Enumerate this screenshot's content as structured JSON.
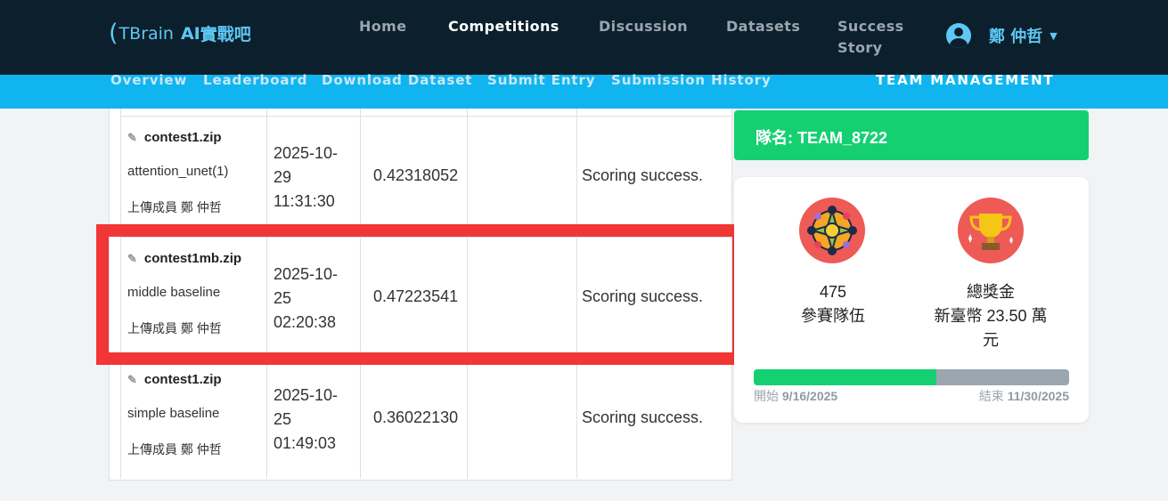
{
  "header": {
    "logo_text": "TBrain",
    "logo_ai": "AI",
    "logo_cn": "實戰吧",
    "nav": [
      "Home",
      "Competitions",
      "Discussion",
      "Datasets",
      "Success",
      "Story"
    ],
    "active_nav": "Competitions",
    "user_name": "鄭 仲哲"
  },
  "subnav": {
    "items": [
      "Overview",
      "Leaderboard",
      "Download Dataset",
      "Submit Entry",
      "Submission History"
    ],
    "team_management": "TEAM MANAGEMENT"
  },
  "submissions": [
    {
      "file": "contest1.zip",
      "description": "attention_unet(1)",
      "uploader": "上傳成員 鄭 仲哲",
      "date_lines": [
        "2025-10-",
        "29",
        "11:31:30"
      ],
      "score": "0.42318052",
      "status": "Scoring success."
    },
    {
      "file": "contest1mb.zip",
      "description": "middle baseline",
      "uploader": "上傳成員 鄭 仲哲",
      "date_lines": [
        "2025-10-",
        "25",
        "02:20:38"
      ],
      "score": "0.47223541",
      "status": "Scoring success."
    },
    {
      "file": "contest1.zip",
      "description": "simple baseline",
      "uploader": "上傳成員 鄭 仲哲",
      "date_lines": [
        "2025-10-",
        "25",
        "01:49:03"
      ],
      "score": "0.36022130",
      "status": "Scoring success."
    }
  ],
  "team": {
    "label": "隊名: TEAM_8722"
  },
  "stats": {
    "teams_count": "475",
    "teams_label": "參賽隊伍",
    "prize_label": "總獎金",
    "prize_line1": "新臺幣 23.50 萬",
    "prize_line2": "元",
    "start_label": "開始",
    "start_date": "9/16/2025",
    "end_label": "結束",
    "end_date": "11/30/2025",
    "progress": 0.58
  },
  "colors": {
    "navbar": "#0c1f2c",
    "subnav": "#10b5f0",
    "accent_green": "#15d071",
    "highlight_red": "#f23535",
    "icon_red": "#ee5a55"
  },
  "icons": [
    "paperclip-icon",
    "user-avatar-icon",
    "caret-down-icon",
    "team-icon",
    "trophy-icon"
  ]
}
